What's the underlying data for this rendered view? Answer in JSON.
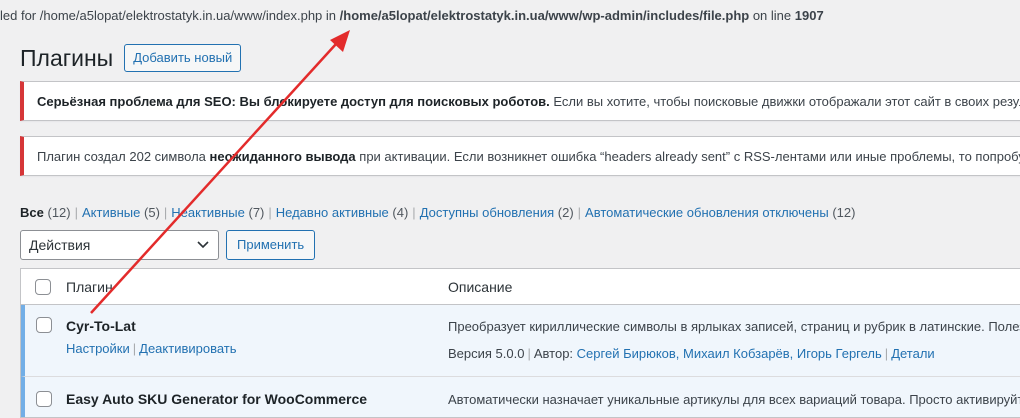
{
  "error_line": {
    "prefix": "led for /home/a5lopat/elektrostatyk.in.ua/www/index.php in ",
    "path": "/home/a5lopat/elektrostatyk.in.ua/www/wp-admin/includes/file.php",
    "on_line": " on line ",
    "line": "1907"
  },
  "header": {
    "title": "Плагины",
    "add_new": "Добавить новый"
  },
  "notices": {
    "seo_bold": "Серьёзная проблема для SEO: Вы блокируете доступ для поисковых роботов.",
    "seo_text": " Если вы хотите, чтобы поисковые движки отображали этот сайт в своих результатах",
    "output_pre": "Плагин создал 202 символа ",
    "output_bold": "неожиданного вывода",
    "output_post": " при активации. Если возникнет ошибка “headers already sent” с RSS-лентами или иные проблемы, то попробуйте"
  },
  "filters": [
    {
      "label": "Все",
      "count": "(12)"
    },
    {
      "label": "Активные",
      "count": "(5)"
    },
    {
      "label": "Неактивные",
      "count": "(7)"
    },
    {
      "label": "Недавно активные",
      "count": "(4)"
    },
    {
      "label": "Доступны обновления",
      "count": "(2)"
    },
    {
      "label": "Автоматические обновления отключены",
      "count": "(12)"
    }
  ],
  "bulk": {
    "selected": "Действия",
    "apply": "Применить"
  },
  "table": {
    "col_plugin": "Плагин",
    "col_description": "Описание",
    "rows": [
      {
        "name": "Cyr-To-Lat",
        "action_settings": "Настройки",
        "action_deactivate": "Деактивировать",
        "description": "Преобразует кириллические символы в ярлыках записей, страниц и рубрик в латинские. Полез",
        "version": "Версия 5.0.0",
        "author_label": "Автор: ",
        "authors": "Сергей Бирюков, Михаил Кобзарёв, Игорь Гергель",
        "details": "Детали"
      },
      {
        "name": "Easy Auto SKU Generator for WooCommerce",
        "description": "Автоматически назначает уникальные артикулы для всех вариаций товара. Просто активируйте"
      }
    ]
  },
  "annotation_color": "#e32b2b"
}
